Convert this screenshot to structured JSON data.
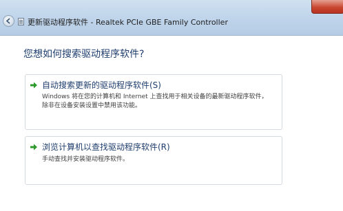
{
  "window": {
    "title": "更新驱动程序软件 - Realtek PCIe GBE Family Controller"
  },
  "main": {
    "question": "您想如何搜索驱动程序软件?",
    "options": [
      {
        "title": "自动搜索更新的驱动程序软件(S)",
        "description": "Windows 将在您的计算机和 Internet 上查找用于相关设备的最新驱动程序软件，除非在设备安装设置中禁用该功能。",
        "icon": "green-arrow-icon"
      },
      {
        "title": "浏览计算机以查找驱动程序软件(R)",
        "description": "手动查找并安装驱动程序软件。",
        "icon": "green-arrow-icon"
      }
    ]
  },
  "colors": {
    "accent_text": "#1f3e6e",
    "arrow_green": "#2e9a2e",
    "titlebar": "#c4d8ec"
  }
}
